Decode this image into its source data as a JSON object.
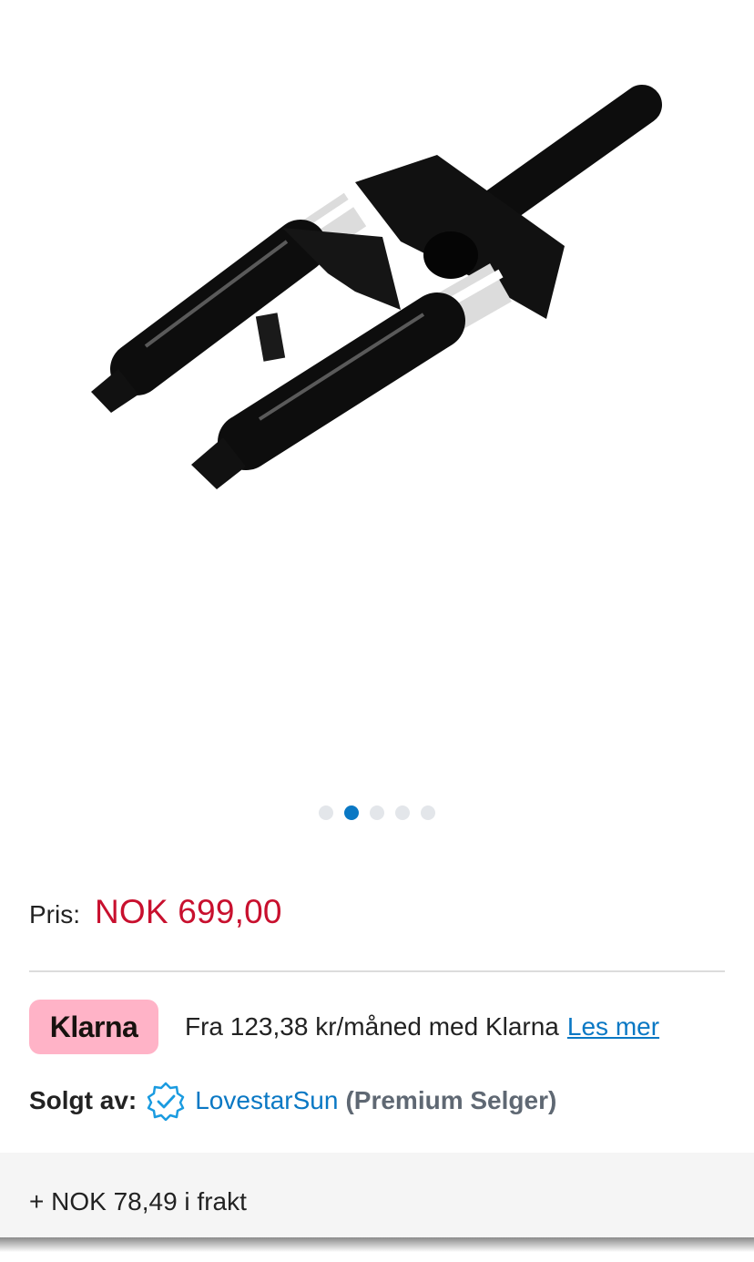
{
  "gallery": {
    "image_icon": "suspension-fork-product-image",
    "slide_count": 5,
    "active_slide": 2
  },
  "price": {
    "label": "Pris:",
    "value": "NOK 699,00",
    "color": "#c8102e"
  },
  "klarna": {
    "badge": "Klarna",
    "text": "Fra 123,38 kr/måned med Klarna",
    "link": "Les mer",
    "badge_color": "#ffb3c7"
  },
  "seller": {
    "label": "Solgt av:",
    "badge_icon": "verified-badge-icon",
    "name": "LovestarSun",
    "tier": "(Premium Selger)"
  },
  "shipping": {
    "text": "+ NOK 78,49 i frakt"
  },
  "accent": "#0a78c4"
}
